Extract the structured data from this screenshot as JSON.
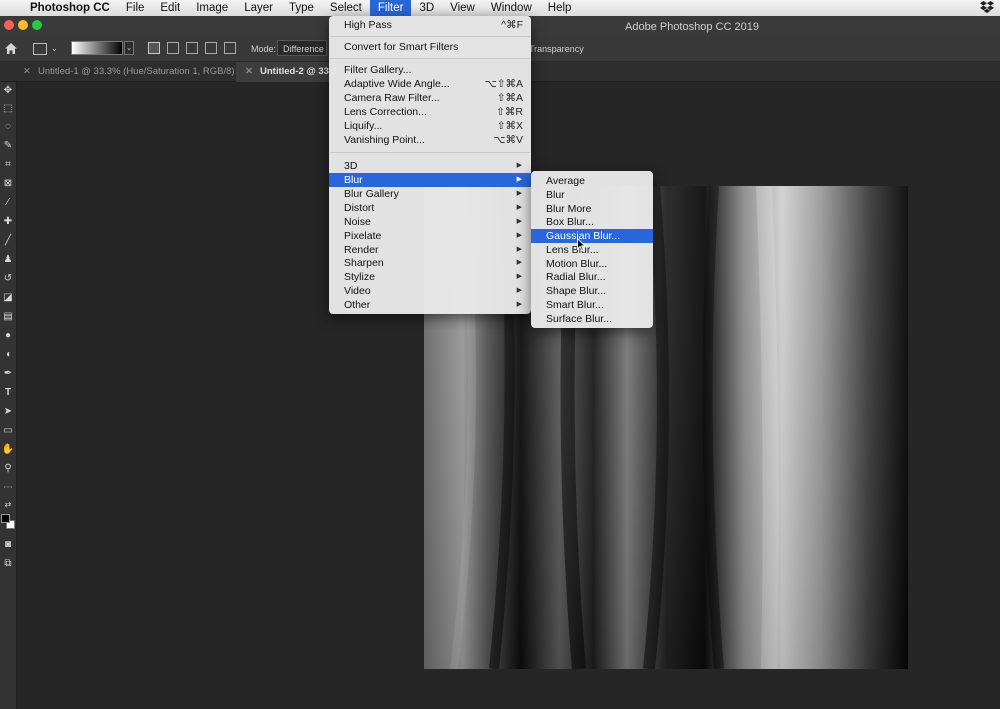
{
  "menubar": {
    "app_name": "Photoshop CC",
    "items": [
      "File",
      "Edit",
      "Image",
      "Layer",
      "Type",
      "Select",
      "Filter",
      "3D",
      "View",
      "Window",
      "Help"
    ],
    "active": "Filter"
  },
  "window": {
    "title": "Adobe Photoshop CC 2019"
  },
  "options": {
    "mode_label": "Mode:",
    "mode_value": "Difference",
    "transparency_label": "Transparency"
  },
  "tabs": [
    {
      "label": "Untitled-1 @ 33.3% (Hue/Saturation 1, RGB/8) *"
    },
    {
      "label": "Untitled-2 @ 33.3"
    }
  ],
  "filter_menu": {
    "items": [
      {
        "label": "High Pass",
        "shortcut": "^⌘F"
      },
      {
        "label": "Convert for Smart Filters",
        "shortcut": ""
      },
      {
        "label": "Filter Gallery...",
        "shortcut": ""
      },
      {
        "label": "Adaptive Wide Angle...",
        "shortcut": "⌥⇧⌘A"
      },
      {
        "label": "Camera Raw Filter...",
        "shortcut": "⇧⌘A"
      },
      {
        "label": "Lens Correction...",
        "shortcut": "⇧⌘R"
      },
      {
        "label": "Liquify...",
        "shortcut": "⇧⌘X"
      },
      {
        "label": "Vanishing Point...",
        "shortcut": "⌥⌘V"
      },
      {
        "label": "3D",
        "shortcut": ""
      },
      {
        "label": "Blur",
        "shortcut": ""
      },
      {
        "label": "Blur Gallery",
        "shortcut": ""
      },
      {
        "label": "Distort",
        "shortcut": ""
      },
      {
        "label": "Noise",
        "shortcut": ""
      },
      {
        "label": "Pixelate",
        "shortcut": ""
      },
      {
        "label": "Render",
        "shortcut": ""
      },
      {
        "label": "Sharpen",
        "shortcut": ""
      },
      {
        "label": "Stylize",
        "shortcut": ""
      },
      {
        "label": "Video",
        "shortcut": ""
      },
      {
        "label": "Other",
        "shortcut": ""
      }
    ],
    "highlighted": "Blur"
  },
  "blur_menu": {
    "items": [
      {
        "label": "Average"
      },
      {
        "label": "Blur"
      },
      {
        "label": "Blur More"
      },
      {
        "label": "Box Blur..."
      },
      {
        "label": "Gaussian Blur..."
      },
      {
        "label": "Lens Blur..."
      },
      {
        "label": "Motion Blur..."
      },
      {
        "label": "Radial Blur..."
      },
      {
        "label": "Shape Blur..."
      },
      {
        "label": "Smart Blur..."
      },
      {
        "label": "Surface Blur..."
      }
    ],
    "highlighted": "Gaussian Blur..."
  },
  "icons": {
    "apple": "apple-icon",
    "home": "home-icon",
    "dropbox": "dropbox-icon",
    "cursor": "pointer-cursor-icon"
  },
  "colors": {
    "menu_highlight": "#2a66d9",
    "panel_bg": "#262626"
  }
}
